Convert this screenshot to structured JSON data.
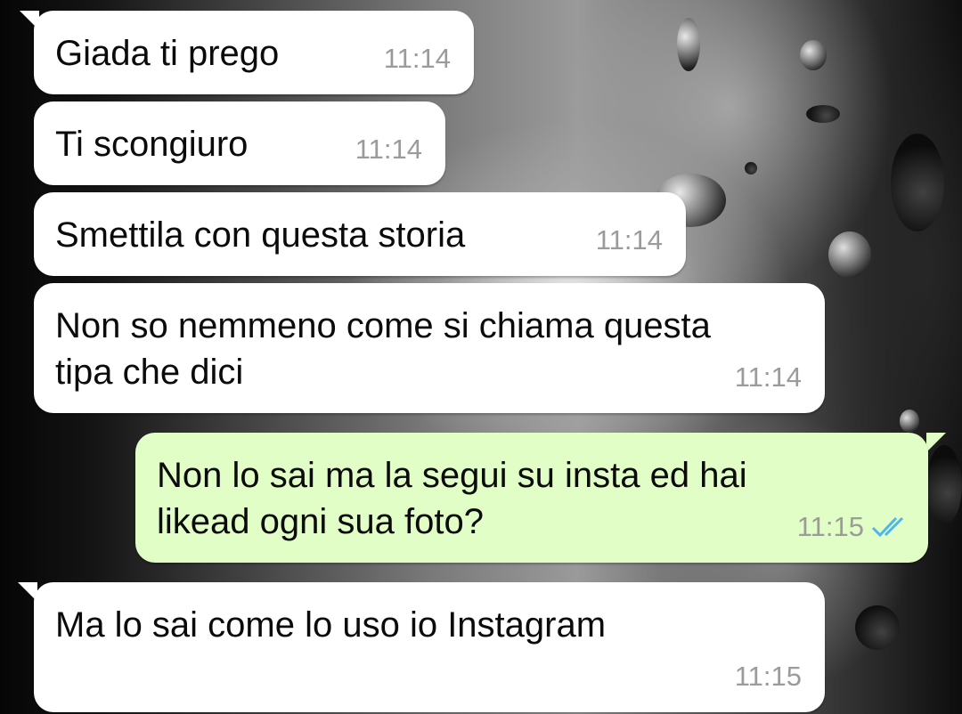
{
  "messages": [
    {
      "text": "Giada ti prego",
      "time": "11:14",
      "direction": "in"
    },
    {
      "text": "Ti scongiuro",
      "time": "11:14",
      "direction": "in"
    },
    {
      "text": "Smettila con questa storia",
      "time": "11:14",
      "direction": "in"
    },
    {
      "text": "Non so nemmeno come si chiama questa\ntipa che dici",
      "time": "11:14",
      "direction": "in"
    },
    {
      "text": "Non lo sai ma la segui su insta ed hai\nlikead ogni sua foto?",
      "time": "11:15",
      "direction": "out",
      "status_icon": "double-check-read-icon"
    },
    {
      "text": "Ma lo sai come lo uso io Instagram",
      "time": "11:15",
      "direction": "in"
    }
  ],
  "colors": {
    "incoming_bubble": "#ffffff",
    "outgoing_bubble": "#e1fec6",
    "timestamp": "#9b9b9b",
    "read_ticks": "#4fb6ec"
  }
}
